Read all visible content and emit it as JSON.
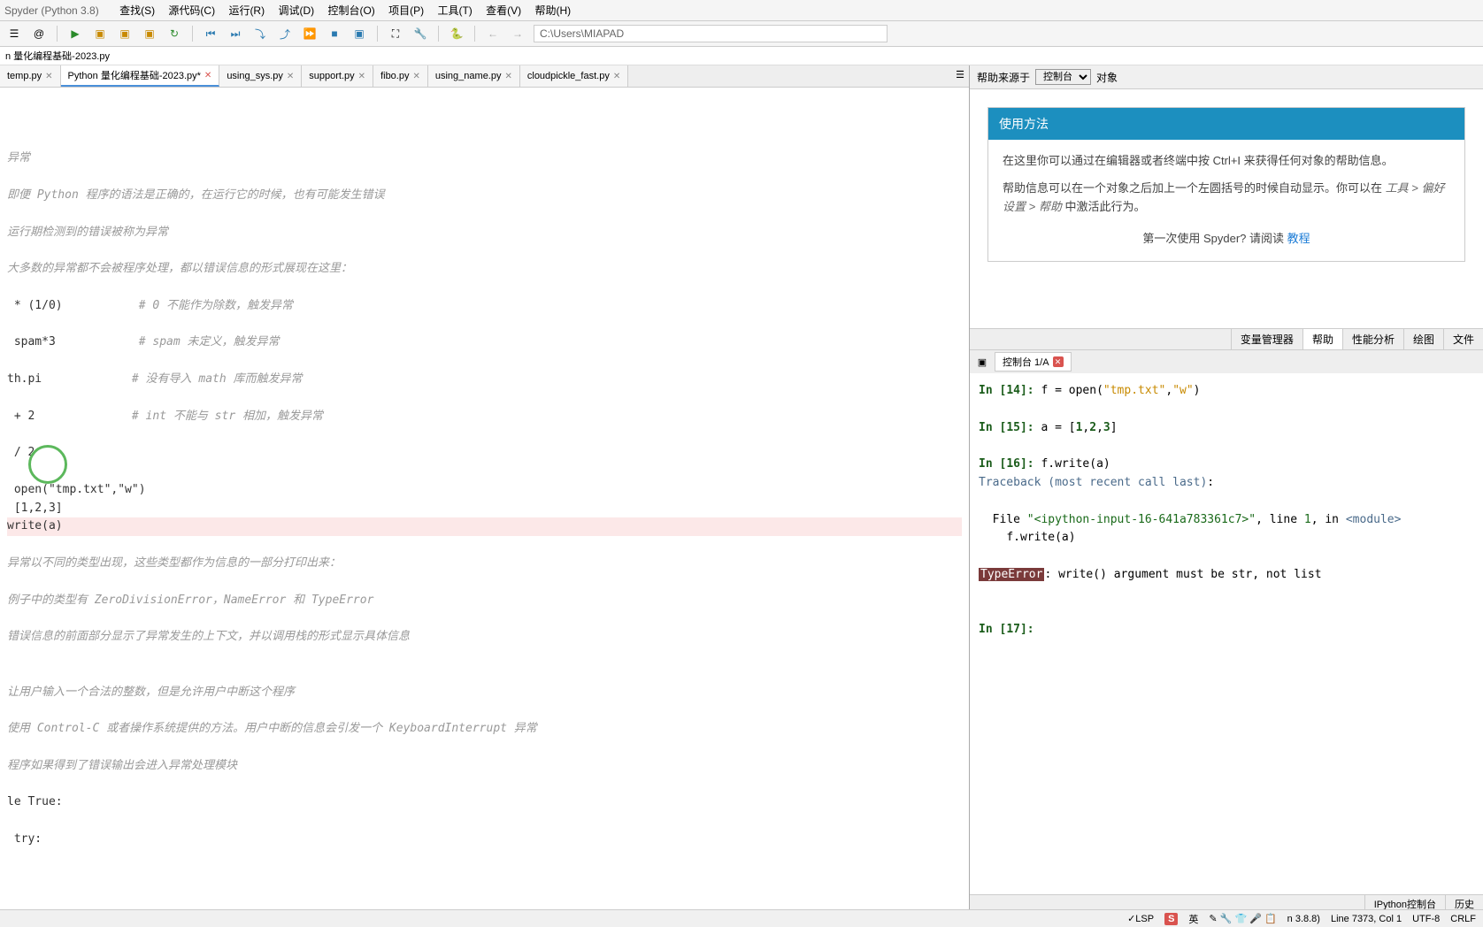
{
  "title": "Spyder (Python 3.8)",
  "menu": [
    "查找(S)",
    "源代码(C)",
    "运行(R)",
    "调试(D)",
    "控制台(O)",
    "项目(P)",
    "工具(T)",
    "查看(V)",
    "帮助(H)"
  ],
  "path": "C:\\Users\\MIAPAD",
  "breadcrumb": "n 量化编程基础-2023.py",
  "tabs": [
    {
      "label": "temp.py",
      "active": false,
      "modified": false
    },
    {
      "label": "Python 量化编程基础-2023.py*",
      "active": true,
      "modified": true
    },
    {
      "label": "using_sys.py",
      "active": false,
      "modified": false
    },
    {
      "label": "support.py",
      "active": false,
      "modified": false
    },
    {
      "label": "fibo.py",
      "active": false,
      "modified": false
    },
    {
      "label": "using_name.py",
      "active": false,
      "modified": false
    },
    {
      "label": "cloudpickle_fast.py",
      "active": false,
      "modified": false
    }
  ],
  "editor_lines": [
    {
      "text": "异常",
      "cls": "comment"
    },
    {
      "text": "",
      "cls": ""
    },
    {
      "text": "即便 Python 程序的语法是正确的，在运行它的时候，也有可能发生错误",
      "cls": "comment"
    },
    {
      "text": "",
      "cls": ""
    },
    {
      "text": "运行期检测到的错误被称为异常",
      "cls": "comment"
    },
    {
      "text": "",
      "cls": ""
    },
    {
      "text": "大多数的异常都不会被程序处理，都以错误信息的形式展现在这里：",
      "cls": "comment"
    },
    {
      "text": "",
      "cls": ""
    },
    {
      "text": " * (1/0)           # 0 不能作为除数，触发异常",
      "cls": ""
    },
    {
      "text": "",
      "cls": ""
    },
    {
      "text": " spam*3            # spam 未定义，触发异常",
      "cls": ""
    },
    {
      "text": "",
      "cls": ""
    },
    {
      "text": "th.pi             # 没有导入 math 库而触发异常",
      "cls": ""
    },
    {
      "text": "",
      "cls": ""
    },
    {
      "text": " + 2              # int 不能与 str 相加，触发异常",
      "cls": ""
    },
    {
      "text": "",
      "cls": ""
    },
    {
      "text": " / 2",
      "cls": ""
    },
    {
      "text": "",
      "cls": ""
    },
    {
      "text": " open(\"tmp.txt\",\"w\")",
      "cls": ""
    },
    {
      "text": " [1,2,3]",
      "cls": ""
    },
    {
      "text": "write(a)",
      "cls": "highlight"
    },
    {
      "text": "",
      "cls": ""
    },
    {
      "text": "异常以不同的类型出现，这些类型都作为信息的一部分打印出来：",
      "cls": "comment"
    },
    {
      "text": "",
      "cls": ""
    },
    {
      "text": "例子中的类型有 ZeroDivisionError，NameError 和 TypeError",
      "cls": "comment"
    },
    {
      "text": "",
      "cls": ""
    },
    {
      "text": "错误信息的前面部分显示了异常发生的上下文，并以调用栈的形式显示具体信息",
      "cls": "comment"
    },
    {
      "text": "",
      "cls": ""
    },
    {
      "text": "",
      "cls": ""
    },
    {
      "text": "让用户输入一个合法的整数，但是允许用户中断这个程序",
      "cls": "comment"
    },
    {
      "text": "",
      "cls": ""
    },
    {
      "text": "使用 Control-C 或者操作系统提供的方法。用户中断的信息会引发一个 KeyboardInterrupt 异常",
      "cls": "comment"
    },
    {
      "text": "",
      "cls": ""
    },
    {
      "text": "程序如果得到了错误输出会进入异常处理模块",
      "cls": "comment"
    },
    {
      "text": "",
      "cls": ""
    },
    {
      "text": "le True:",
      "cls": ""
    },
    {
      "text": "",
      "cls": ""
    },
    {
      "text": " try:",
      "cls": ""
    }
  ],
  "help": {
    "source_label": "帮助来源于",
    "source_value": "控制台",
    "object_label": "对象",
    "card_title": "使用方法",
    "p1": "在这里你可以通过在编辑器或者终端中按 Ctrl+I 来获得任何对象的帮助信息。",
    "p2a": "帮助信息可以在一个对象之后加上一个左圆括号的时候自动显示。你可以在 ",
    "p2b": "工具 > 偏好设置 > 帮助",
    "p2c": " 中激活此行为。",
    "tutorial_prefix": "第一次使用 Spyder? 请阅读 ",
    "tutorial_link": "教程"
  },
  "right_tabs": [
    "变量管理器",
    "帮助",
    "性能分析",
    "绘图",
    "文件"
  ],
  "right_tab_active": 1,
  "console_tab": "控制台 1/A",
  "console": {
    "in14": "In [14]: f = open(\"tmp.txt\",\"w\")",
    "in15": "In [15]: a = [1,2,3]",
    "in16": "In [16]: f.write(a)",
    "tb": "Traceback (most recent call last):",
    "file_line": "  File \"<ipython-input-16-641a783361c7>\", line 1, in <module>",
    "call": "    f.write(a)",
    "err": "TypeError",
    "err_msg": ": write() argument must be str, not list",
    "in17": "In [17]: "
  },
  "bottom_tabs": [
    "IPython控制台",
    "历史"
  ],
  "status": {
    "lsp": "✓LSP",
    "ime": "英",
    "python": "n 3.8.8)",
    "line": "Line 7373, Col 1",
    "enc": "UTF-8",
    "eol": "CRLF"
  }
}
